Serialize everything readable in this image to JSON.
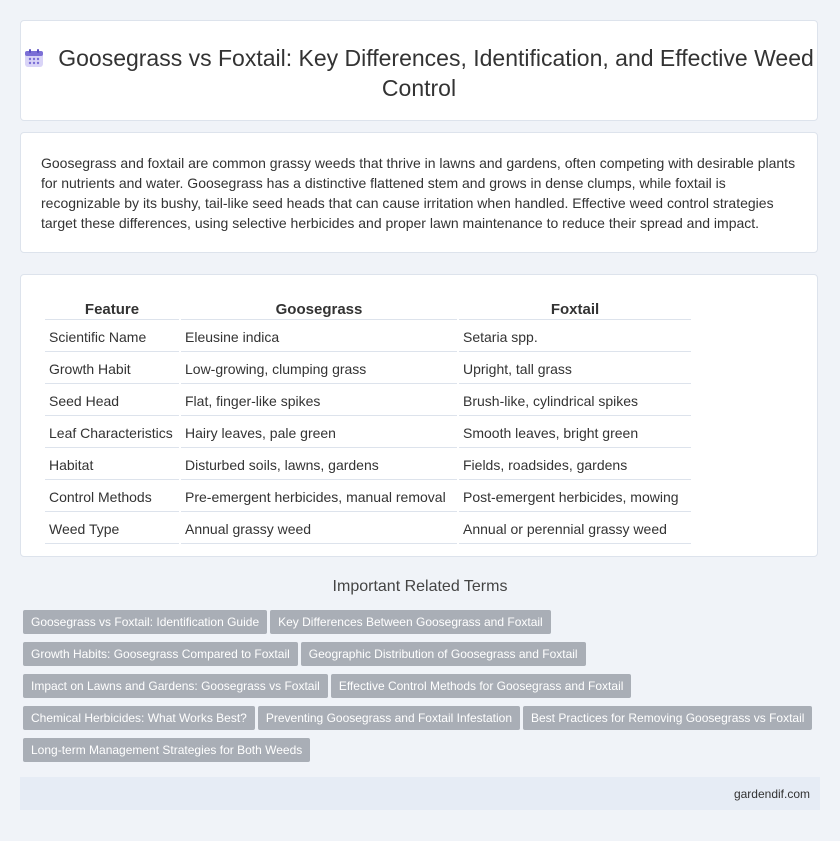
{
  "header": {
    "title": "Goosegrass vs Foxtail: Key Differences, Identification, and Effective Weed Control",
    "icon": "calendar-icon"
  },
  "intro": {
    "text": "Goosegrass and foxtail are common grassy weeds that thrive in lawns and gardens, often competing with desirable plants for nutrients and water. Goosegrass has a distinctive flattened stem and grows in dense clumps, while foxtail is recognizable by its bushy, tail-like seed heads that can cause irritation when handled. Effective weed control strategies target these differences, using selective herbicides and proper lawn maintenance to reduce their spread and impact."
  },
  "table": {
    "headers": [
      "Feature",
      "Goosegrass",
      "Foxtail"
    ],
    "rows": [
      [
        "Scientific Name",
        "Eleusine indica",
        "Setaria spp."
      ],
      [
        "Growth Habit",
        "Low-growing, clumping grass",
        "Upright, tall grass"
      ],
      [
        "Seed Head",
        "Flat, finger-like spikes",
        "Brush-like, cylindrical spikes"
      ],
      [
        "Leaf Characteristics",
        "Hairy leaves, pale green",
        "Smooth leaves, bright green"
      ],
      [
        "Habitat",
        "Disturbed soils, lawns, gardens",
        "Fields, roadsides, gardens"
      ],
      [
        "Control Methods",
        "Pre-emergent herbicides, manual removal",
        "Post-emergent herbicides, mowing"
      ],
      [
        "Weed Type",
        "Annual grassy weed",
        "Annual or perennial grassy weed"
      ]
    ]
  },
  "related": {
    "title": "Important Related Terms",
    "tags": [
      "Goosegrass vs Foxtail: Identification Guide",
      "Key Differences Between Goosegrass and Foxtail",
      "Growth Habits: Goosegrass Compared to Foxtail",
      "Geographic Distribution of Goosegrass and Foxtail",
      "Impact on Lawns and Gardens: Goosegrass vs Foxtail",
      "Effective Control Methods for Goosegrass and Foxtail",
      "Chemical Herbicides: What Works Best?",
      "Preventing Goosegrass and Foxtail Infestation",
      "Best Practices for Removing Goosegrass vs Foxtail",
      "Long-term Management Strategies for Both Weeds"
    ]
  },
  "footer": {
    "site": "gardendif.com"
  },
  "colors": {
    "background": "#f0f3f8",
    "tag_bg": "#a9aeb6",
    "footer_bg": "#e6ecf5",
    "icon_accent": "#7b6fd6"
  }
}
